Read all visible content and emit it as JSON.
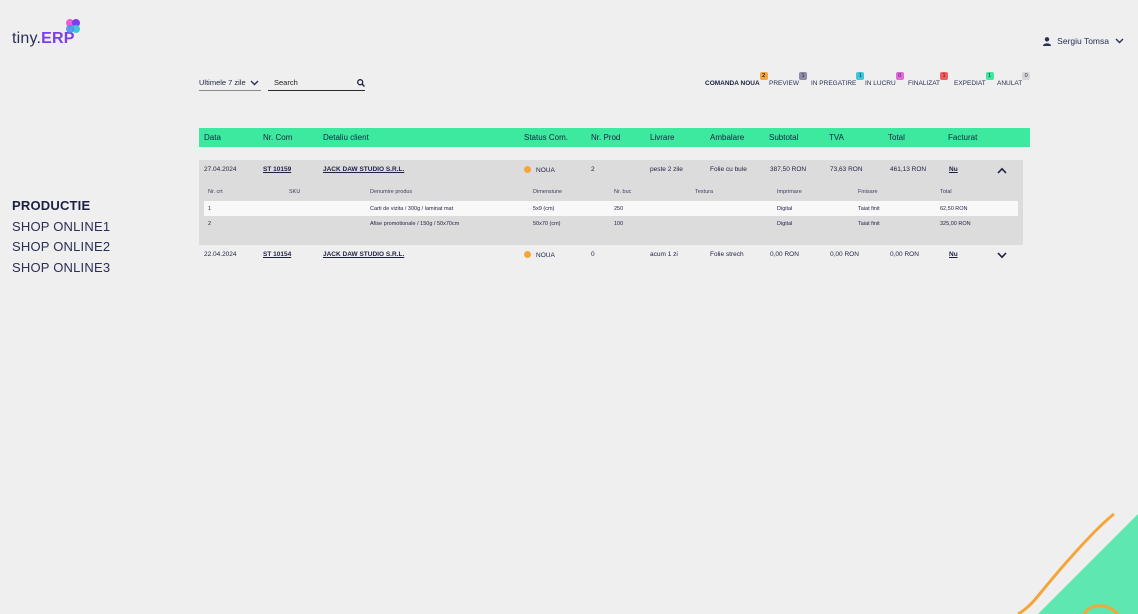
{
  "brand": {
    "name_prefix": "tiny.",
    "name_accent": "ERP"
  },
  "user": {
    "name": "Sergiu Tomsa"
  },
  "sidebar": {
    "items": [
      {
        "label": "PRODUCTIE",
        "active": true
      },
      {
        "label": "SHOP ONLINE1",
        "active": false
      },
      {
        "label": "SHOP ONLINE2",
        "active": false
      },
      {
        "label": "SHOP ONLINE3",
        "active": false
      }
    ]
  },
  "filter": {
    "selected": "Ultimele 7 zile"
  },
  "search": {
    "placeholder": "Search",
    "value": ""
  },
  "status_tabs": [
    {
      "label": "COMANDA NOUA",
      "count": "2",
      "color": "#f4a63a",
      "active": true
    },
    {
      "label": "PREVIEW",
      "count": "1",
      "color": "#8f8aa8"
    },
    {
      "label": "IN PREGATIRE",
      "count": "1",
      "color": "#3ec7d8"
    },
    {
      "label": "IN LUCRU",
      "count": "0",
      "color": "#e06bd6"
    },
    {
      "label": "FINALIZAT",
      "count": "1",
      "color": "#f25c5c"
    },
    {
      "label": "EXPEDIAT",
      "count": "1",
      "color": "#3de89f"
    },
    {
      "label": "ANULAT",
      "count": "0",
      "color": "#d6d6d6"
    }
  ],
  "table": {
    "headers": [
      "Data",
      "Nr. Com",
      "Detaliu client",
      "Status Com.",
      "Nr. Prod",
      "Livrare",
      "Ambalare",
      "Subtotal",
      "TVA",
      "Total",
      "Facturat"
    ],
    "rows": [
      {
        "date": "27.04.2024",
        "nr_com": "ST 10159",
        "client": "JACK DAW STUDIO S.R.L.",
        "status": "NOUA",
        "status_color": "#f4a63a",
        "nr_prod": "2",
        "livrare": "peste 2 zile",
        "ambalare": "Folie cu bule",
        "subtotal": "387,50 RON",
        "tva": "73,63 RON",
        "total": "461,13 RON",
        "facturat": "Nu",
        "expanded": true,
        "products": {
          "headers": [
            "Nr. crt",
            "SKU",
            "Denumire produs",
            "Dimensiune",
            "Nr. buc",
            "Textura",
            "Imprimare",
            "Finisare",
            "Total"
          ],
          "items": [
            {
              "nr": "1",
              "sku": "",
              "name": "Carti de vizita / 300g / laminat mat",
              "dim": "5x9 (cm)",
              "buc": "250",
              "textura": "",
              "imprimare": "Digital",
              "finisare": "Taiat finit",
              "total": "62,50 RON"
            },
            {
              "nr": "2",
              "sku": "",
              "name": "Afise promotionale / 150g / 50x70cm",
              "dim": "50x70 (cm)",
              "buc": "100",
              "textura": "",
              "imprimare": "Digital",
              "finisare": "Taiat finit",
              "total": "325,00 RON"
            }
          ]
        }
      },
      {
        "date": "22.04.2024",
        "nr_com": "ST 10154",
        "client": "JACK DAW STUDIO S.R.L.",
        "status": "NOUA",
        "status_color": "#f4a63a",
        "nr_prod": "0",
        "livrare": "acum 1 zi",
        "ambalare": "Folie strech",
        "subtotal": "0,00 RON",
        "tva": "0,00 RON",
        "total": "0,00 RON",
        "facturat": "Nu",
        "expanded": false
      }
    ]
  },
  "colors": {
    "accent": "#3de89f",
    "brand": "#7a3df0",
    "deco_orange": "#f4a63a"
  }
}
